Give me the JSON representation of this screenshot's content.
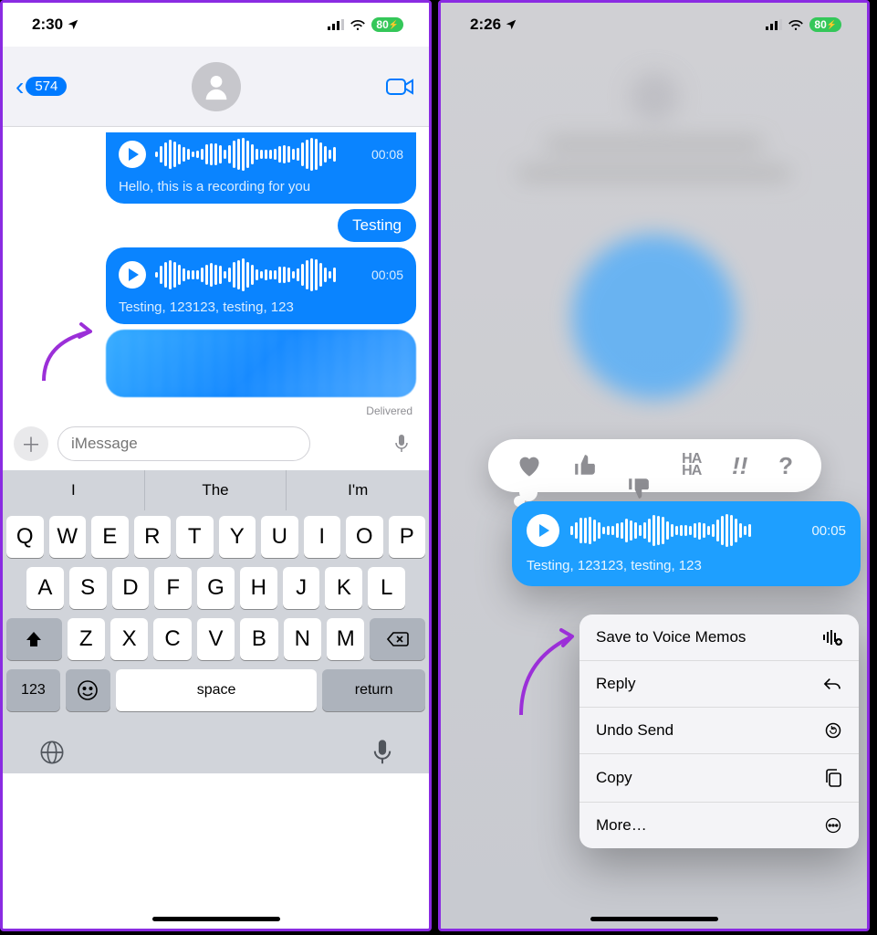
{
  "left": {
    "status": {
      "time": "2:30",
      "battery": "80"
    },
    "nav": {
      "unread": "574"
    },
    "messages": {
      "audio1_duration": "00:08",
      "audio1_transcript": "Hello, this is a recording for you",
      "text1": "Testing",
      "audio2_duration": "00:05",
      "audio2_transcript": "Testing, 123123, testing, 123",
      "delivered": "Delivered"
    },
    "input": {
      "placeholder": "iMessage"
    },
    "suggestions": [
      "I",
      "The",
      "I'm"
    ],
    "keys_row1": [
      "Q",
      "W",
      "E",
      "R",
      "T",
      "Y",
      "U",
      "I",
      "O",
      "P"
    ],
    "keys_row2": [
      "A",
      "S",
      "D",
      "F",
      "G",
      "H",
      "J",
      "K",
      "L"
    ],
    "keys_row3": [
      "Z",
      "X",
      "C",
      "V",
      "B",
      "N",
      "M"
    ],
    "keys_bottom": {
      "num": "123",
      "space": "space",
      "ret": "return"
    }
  },
  "right": {
    "status": {
      "time": "2:26",
      "battery": "80"
    },
    "tapbacks": [
      "heart",
      "thumbs-up",
      "thumbs-down",
      "haha",
      "exclaim",
      "question"
    ],
    "focus_audio": {
      "duration": "00:05",
      "transcript": "Testing, 123123, testing, 123"
    },
    "menu": [
      {
        "label": "Save to Voice Memos",
        "icon": "waveform-plus"
      },
      {
        "label": "Reply",
        "icon": "reply"
      },
      {
        "label": "Undo Send",
        "icon": "undo"
      },
      {
        "label": "Copy",
        "icon": "copy"
      },
      {
        "label": "More…",
        "icon": "more"
      }
    ]
  }
}
